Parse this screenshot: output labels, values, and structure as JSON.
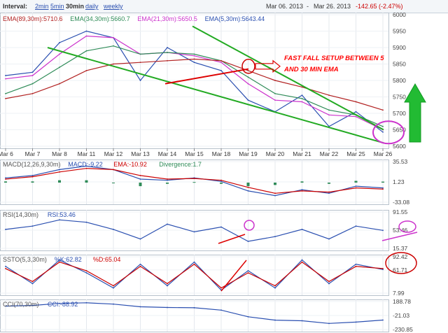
{
  "header": {
    "interval_label": "Interval:",
    "intervals": [
      "2min",
      "5min",
      "30min",
      "daily",
      "weekly"
    ],
    "date_from": "Mar 06. 2013",
    "date_sep": "-",
    "date_to": "Mar 26. 2013",
    "change": "-142.65 (-2.47%)"
  },
  "price_panel": {
    "legend": [
      {
        "text": "EMA(89,30m):5710.6",
        "color": "#b22222"
      },
      {
        "text": "EMA(34,30m):5660.7",
        "color": "#2e8b57"
      },
      {
        "text": "EMA(21,30m):5650.5",
        "color": "#cc33cc"
      },
      {
        "text": "EMA(5,30m):5643.44",
        "color": "#2a4fb0"
      }
    ],
    "annotation_lines": [
      "FAST FALL SETUP BETWEEN 5",
      "AND 30 MIN EMA"
    ],
    "annotation_color": "#ff0000"
  },
  "chart_data": [
    {
      "type": "line",
      "panel": "price",
      "ylim": [
        5600,
        6000
      ],
      "y_ticks": [
        "6000",
        "5950",
        "5900",
        "5850",
        "5800",
        "5750",
        "5700",
        "5650",
        "5600"
      ],
      "categories": [
        "Mar 6",
        "Mar 7",
        "Mar 8",
        "Mar 11",
        "Mar 12",
        "Mar 13",
        "Mar 14",
        "Mar 15",
        "Mar 18",
        "Mar 19",
        "Mar 20",
        "Mar 21",
        "Mar 22",
        "Mar 25",
        "Mar 26"
      ],
      "series": [
        {
          "name": "EMA(5,30m)",
          "color": "#2a4fb0",
          "values": [
            5815,
            5825,
            5915,
            5950,
            5930,
            5800,
            5900,
            5855,
            5830,
            5740,
            5705,
            5755,
            5660,
            5705,
            5643
          ]
        },
        {
          "name": "EMA(21,30m)",
          "color": "#cc33cc",
          "values": [
            5805,
            5815,
            5880,
            5935,
            5930,
            5880,
            5885,
            5875,
            5855,
            5790,
            5740,
            5735,
            5695,
            5690,
            5650
          ]
        },
        {
          "name": "EMA(34,30m)",
          "color": "#2e8b57",
          "values": [
            5760,
            5790,
            5840,
            5890,
            5905,
            5880,
            5885,
            5880,
            5860,
            5810,
            5760,
            5745,
            5710,
            5695,
            5660
          ]
        },
        {
          "name": "EMA(89,30m)",
          "color": "#b22222",
          "values": [
            5745,
            5760,
            5790,
            5830,
            5850,
            5855,
            5860,
            5865,
            5860,
            5830,
            5800,
            5780,
            5755,
            5735,
            5710
          ]
        }
      ]
    },
    {
      "type": "bar",
      "panel": "macd",
      "title": "MACD(12,26,9,30m)",
      "legend": [
        {
          "text": "MACD:-9.22",
          "color": "#2a4fb0"
        },
        {
          "text": "EMA:-10.92",
          "color": "#cc0000"
        },
        {
          "text": "Divergence:1.7",
          "color": "#2e8b57"
        }
      ],
      "y_ticks": [
        "35.53",
        "1.23",
        "-33.08"
      ],
      "ylim": [
        -33.08,
        35.53
      ],
      "series": [
        {
          "name": "MACD",
          "color": "#2a4fb0",
          "values": [
            8,
            12,
            22,
            28,
            22,
            6,
            4,
            8,
            2,
            -14,
            -22,
            -12,
            -18,
            -6,
            -9
          ]
        },
        {
          "name": "EMA",
          "color": "#cc0000",
          "values": [
            6,
            10,
            18,
            24,
            22,
            12,
            6,
            7,
            4,
            -8,
            -18,
            -14,
            -16,
            -9,
            -11
          ]
        },
        {
          "name": "Divergence",
          "color": "#2e8b57",
          "values": [
            2,
            2,
            4,
            4,
            0,
            -6,
            -2,
            1,
            -2,
            -6,
            -4,
            2,
            -2,
            3,
            1.7
          ]
        }
      ]
    },
    {
      "type": "line",
      "panel": "rsi",
      "title": "RSI(14,30m)",
      "legend": [
        {
          "text": "RSI:53.46",
          "color": "#2a4fb0"
        }
      ],
      "y_ticks": [
        "91.55",
        "53.46",
        "15.37"
      ],
      "ylim": [
        15.37,
        91.55
      ],
      "series": [
        {
          "name": "RSI",
          "color": "#2a4fb0",
          "values": [
            55,
            62,
            75,
            70,
            55,
            35,
            66,
            50,
            60,
            30,
            40,
            55,
            35,
            62,
            53
          ]
        }
      ]
    },
    {
      "type": "line",
      "panel": "ssto",
      "title": "SSTO(5,3,30m)",
      "legend": [
        {
          "text": "%K:62.82",
          "color": "#2a4fb0"
        },
        {
          "text": "%D:65.04",
          "color": "#cc0000"
        }
      ],
      "y_ticks": [
        "92.42",
        "61.71",
        "7.99"
      ],
      "ylim": [
        7.99,
        92.42
      ],
      "series": [
        {
          "name": "%K",
          "color": "#2a4fb0",
          "values": [
            70,
            30,
            85,
            55,
            20,
            75,
            25,
            80,
            15,
            60,
            20,
            85,
            30,
            75,
            62.82
          ]
        },
        {
          "name": "%D",
          "color": "#cc0000",
          "values": [
            65,
            35,
            80,
            60,
            25,
            70,
            30,
            75,
            20,
            55,
            25,
            80,
            35,
            70,
            65.04
          ]
        }
      ]
    },
    {
      "type": "line",
      "panel": "cci",
      "title": "CCI(70,30m)",
      "legend": [
        {
          "text": "CCI:-88.92",
          "color": "#2a4fb0"
        }
      ],
      "y_ticks": [
        "188.78",
        "-21.03",
        "-230.85"
      ],
      "ylim": [
        -230.85,
        188.78
      ],
      "series": [
        {
          "name": "CCI",
          "color": "#2a4fb0",
          "values": [
            120,
            130,
            160,
            170,
            150,
            110,
            100,
            95,
            60,
            -40,
            -90,
            -100,
            -140,
            -120,
            -89
          ]
        }
      ]
    }
  ]
}
